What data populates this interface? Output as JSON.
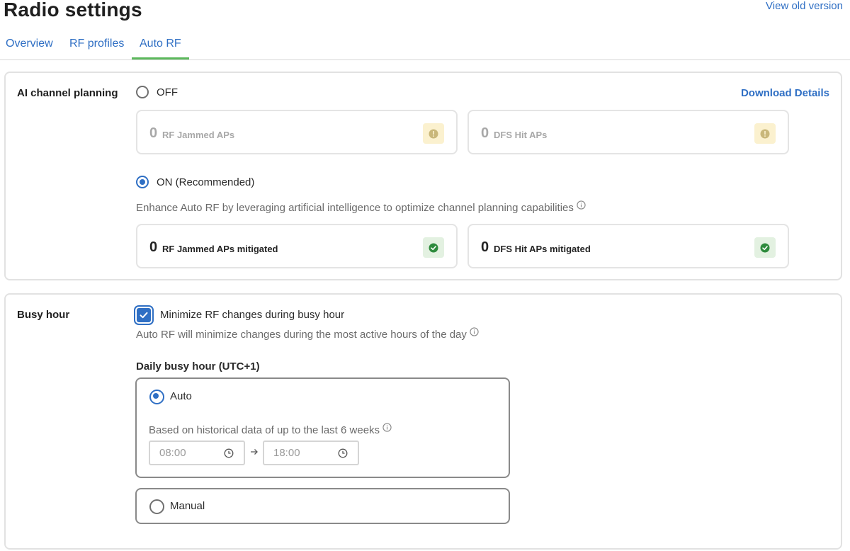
{
  "header": {
    "title": "Radio settings",
    "view_old": "View old version"
  },
  "tabs": [
    {
      "label": "Overview",
      "active": false
    },
    {
      "label": "RF profiles",
      "active": false
    },
    {
      "label": "Auto RF",
      "active": true
    }
  ],
  "ai_channel": {
    "section_label": "AI channel planning",
    "download_label": "Download Details",
    "off_option": {
      "label": "OFF",
      "selected": false,
      "stats": [
        {
          "value": "0",
          "label": "RF Jammed APs",
          "icon": "warning-icon"
        },
        {
          "value": "0",
          "label": "DFS Hit APs",
          "icon": "warning-icon"
        }
      ]
    },
    "on_option": {
      "label": "ON (Recommended)",
      "selected": true,
      "description": "Enhance Auto RF by leveraging artificial intelligence to optimize channel planning capabilities",
      "stats": [
        {
          "value": "0",
          "label": "RF Jammed APs mitigated",
          "icon": "check-circle-icon"
        },
        {
          "value": "0",
          "label": "DFS Hit APs mitigated",
          "icon": "check-circle-icon"
        }
      ]
    }
  },
  "busy_hour": {
    "section_label": "Busy hour",
    "checkbox_label": "Minimize RF changes during busy hour",
    "checkbox_checked": true,
    "description": "Auto RF will minimize changes during the most active hours of the day",
    "daily_label": "Daily busy hour (UTC+1)",
    "auto_option": {
      "label": "Auto",
      "selected": true,
      "description": "Based on historical data of up to the last 6 weeks",
      "start_time": "08:00",
      "end_time": "18:00"
    },
    "manual_option": {
      "label": "Manual",
      "selected": false
    }
  },
  "colors": {
    "accent": "#2f6fc4",
    "tab_underline": "#5cb85c",
    "warning_bg": "#fbf1cf",
    "success_bg": "#e3f1e1",
    "success": "#2e8b3d"
  }
}
